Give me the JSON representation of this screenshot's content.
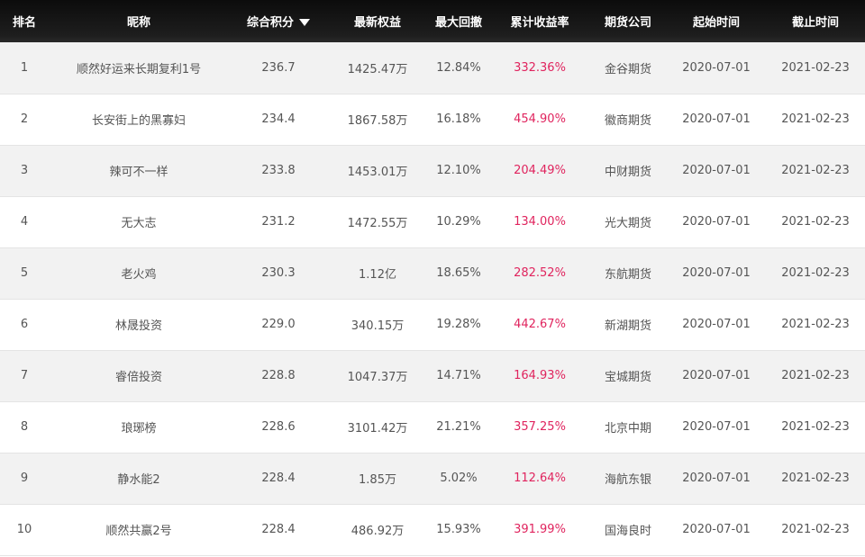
{
  "table": {
    "headers": {
      "rank": "排名",
      "nickname": "昵称",
      "score": "综合积分",
      "equity": "最新权益",
      "drawdown": "最大回撤",
      "return": "累计收益率",
      "company": "期货公司",
      "start": "起始时间",
      "end": "截止时间"
    },
    "sort_icon": "sort-desc-triangle-icon",
    "return_color": "#e0245e",
    "rows": [
      {
        "rank": "1",
        "nickname": "顺然好运来长期复利1号",
        "score": "236.7",
        "equity": "1425.47万",
        "drawdown": "12.84%",
        "return": "332.36%",
        "company": "金谷期货",
        "start": "2020-07-01",
        "end": "2021-02-23"
      },
      {
        "rank": "2",
        "nickname": "长安街上的黑寡妇",
        "score": "234.4",
        "equity": "1867.58万",
        "drawdown": "16.18%",
        "return": "454.90%",
        "company": "徽商期货",
        "start": "2020-07-01",
        "end": "2021-02-23"
      },
      {
        "rank": "3",
        "nickname": "辣可不一样",
        "score": "233.8",
        "equity": "1453.01万",
        "drawdown": "12.10%",
        "return": "204.49%",
        "company": "中财期货",
        "start": "2020-07-01",
        "end": "2021-02-23"
      },
      {
        "rank": "4",
        "nickname": "无大志",
        "score": "231.2",
        "equity": "1472.55万",
        "drawdown": "10.29%",
        "return": "134.00%",
        "company": "光大期货",
        "start": "2020-07-01",
        "end": "2021-02-23"
      },
      {
        "rank": "5",
        "nickname": "老火鸡",
        "score": "230.3",
        "equity": "1.12亿",
        "drawdown": "18.65%",
        "return": "282.52%",
        "company": "东航期货",
        "start": "2020-07-01",
        "end": "2021-02-23"
      },
      {
        "rank": "6",
        "nickname": "林晟投资",
        "score": "229.0",
        "equity": "340.15万",
        "drawdown": "19.28%",
        "return": "442.67%",
        "company": "新湖期货",
        "start": "2020-07-01",
        "end": "2021-02-23"
      },
      {
        "rank": "7",
        "nickname": "睿倍投资",
        "score": "228.8",
        "equity": "1047.37万",
        "drawdown": "14.71%",
        "return": "164.93%",
        "company": "宝城期货",
        "start": "2020-07-01",
        "end": "2021-02-23"
      },
      {
        "rank": "8",
        "nickname": "琅琊榜",
        "score": "228.6",
        "equity": "3101.42万",
        "drawdown": "21.21%",
        "return": "357.25%",
        "company": "北京中期",
        "start": "2020-07-01",
        "end": "2021-02-23"
      },
      {
        "rank": "9",
        "nickname": "静水能2",
        "score": "228.4",
        "equity": "1.85万",
        "drawdown": "5.02%",
        "return": "112.64%",
        "company": "海航东银",
        "start": "2020-07-01",
        "end": "2021-02-23"
      },
      {
        "rank": "10",
        "nickname": "顺然共赢2号",
        "score": "228.4",
        "equity": "486.92万",
        "drawdown": "15.93%",
        "return": "391.99%",
        "company": "国海良时",
        "start": "2020-07-01",
        "end": "2021-02-23"
      }
    ]
  }
}
